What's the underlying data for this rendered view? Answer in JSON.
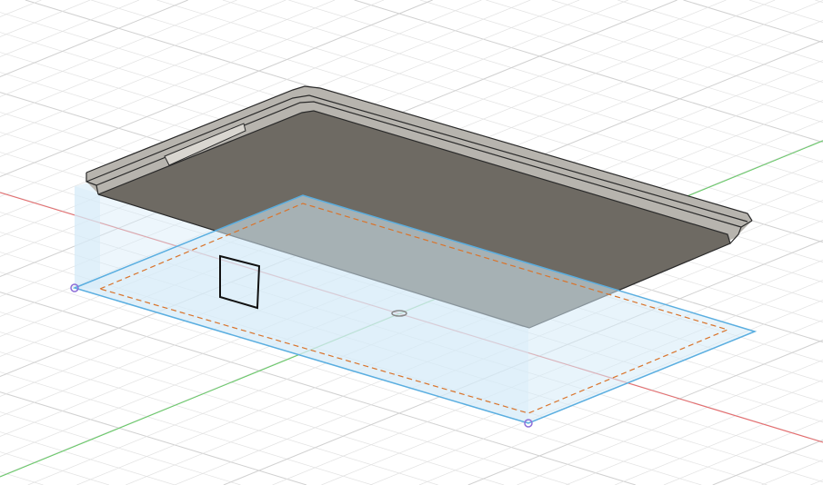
{
  "viewport": {
    "background": "#ffffff",
    "grid_color": "#e2e2e2",
    "grid_major_color": "#d0d0d0"
  },
  "axes": {
    "x_axis_color": "#e8696b",
    "y_axis_color": "#66cc66"
  },
  "sketch_plane": {
    "outline_color": "#5aaee0",
    "fill_color": "#d6ebf8",
    "offset_line_color": "#d9742c",
    "point_color": "#8e6fd8"
  },
  "body": {
    "top_color": "#b7b4ae",
    "bottom_color": "#6e6a63",
    "edge_color": "#2a2a2a"
  },
  "icons": [
    "origin-point-icon",
    "sketch-point-icon"
  ]
}
